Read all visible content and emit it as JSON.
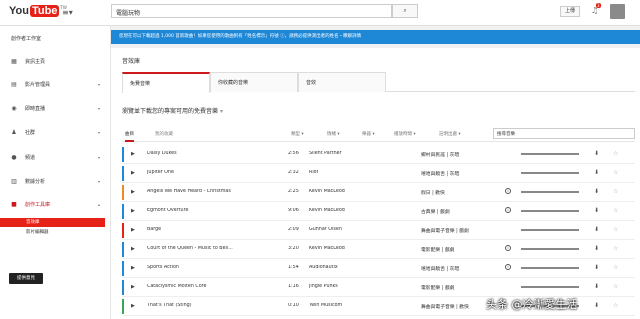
{
  "topbar": {
    "logo_you": "You",
    "logo_tube": "Tube",
    "logo_tw": "TW",
    "search_value": "電腦玩物",
    "upload_label": "上傳",
    "notifications": "3"
  },
  "sidebar": {
    "heading": "創作者工作室",
    "items": [
      {
        "icon": "dashboard-icon",
        "glyph": "▦",
        "label": "資訊主頁",
        "caret": ""
      },
      {
        "icon": "video-manager-icon",
        "glyph": "▤",
        "label": "影片管理員",
        "caret": "▾"
      },
      {
        "icon": "live-icon",
        "glyph": "◉",
        "label": "即時直播",
        "caret": "▾"
      },
      {
        "icon": "community-icon",
        "glyph": "♟",
        "label": "社群",
        "caret": "▾"
      },
      {
        "icon": "channel-icon",
        "glyph": "●",
        "label": "頻道",
        "caret": "▾"
      },
      {
        "icon": "analytics-icon",
        "glyph": "▥",
        "label": "數據分析",
        "caret": "▾"
      },
      {
        "icon": "create-icon",
        "glyph": "▶",
        "label": "創作工具庫",
        "caret": "▴"
      }
    ],
    "sub": [
      "音效庫",
      "影片編輯器"
    ],
    "feedback": "提供意見"
  },
  "notice": "您現在可以下載超過 1,000 首新歌曲！如果您使用的歌曲附有「姓名標示」符號 ⓘ，請務必提供演出者的姓名・瞭解詳情",
  "main": {
    "title": "音效庫",
    "tabs": [
      "免費音樂",
      "你收藏的音樂",
      "音效"
    ],
    "subtitle": "瀏覽並下載您的專案可用的免費音樂",
    "filters": {
      "tab_all": "曲目",
      "tab_fav": "我的收藏",
      "genre": "類型 ▾",
      "mood": "情緒 ▾",
      "instrument": "樂器 ▾",
      "duration": "播放時間 ▾",
      "attribution": "註明出處 ▾",
      "search_placeholder": "搜尋音樂"
    }
  },
  "tracks": [
    {
      "title": "Daisy Dukes",
      "time": "2:56",
      "artist": "Silent Partner",
      "genre": "鄉村與民謠 | 灰暗",
      "cc": false,
      "color": "#1e88d7"
    },
    {
      "title": "Jupiter One",
      "time": "2:32",
      "artist": "Riot",
      "genre": "嘻哈與饒舌 | 灰暗",
      "cc": false,
      "color": "#1e88d7"
    },
    {
      "title": "Angels We Have Heard - Christmas",
      "time": "2:25",
      "artist": "Kevin MacLeod",
      "genre": "假日 | 歡快",
      "cc": true,
      "color": "#f08a24"
    },
    {
      "title": "Egmont Overture",
      "time": "9:06",
      "artist": "Kevin MacLeod",
      "genre": "古典樂 | 戲劇",
      "cc": true,
      "color": "#1e88d7"
    },
    {
      "title": "Barge",
      "time": "2:09",
      "artist": "Gunnar Olsen",
      "genre": "舞曲與電子音樂 | 戲劇",
      "cc": false,
      "color": "#e62117"
    },
    {
      "title": "Court of the Queen - Music to Beli...",
      "time": "3:20",
      "artist": "Kevin MacLeod",
      "genre": "電影配樂 | 戲劇",
      "cc": true,
      "color": "#1e88d7"
    },
    {
      "title": "Sports Action",
      "time": "1:54",
      "artist": "Audionautix",
      "genre": "嘻哈與饒舌 | 灰暗",
      "cc": true,
      "color": "#1e88d7"
    },
    {
      "title": "Cataclysmic Molten Core",
      "time": "1:16",
      "artist": "Jingle Punks",
      "genre": "電影配樂 | 戲劇",
      "cc": false,
      "color": "#1e88d7"
    },
    {
      "title": "That's That (Sting)",
      "time": "0:10",
      "artist": "Twin Musicom",
      "genre": "舞曲與電子音樂 | 歡快",
      "cc": false,
      "color": "#3aa757"
    }
  ],
  "watermark": "头条 @冷漸愛生活"
}
